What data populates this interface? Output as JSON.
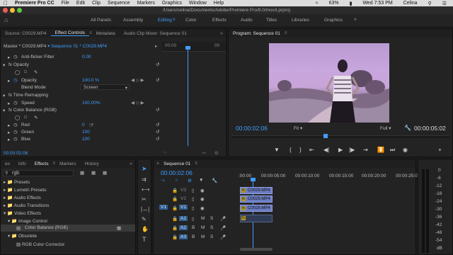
{
  "menubar": {
    "apple": "",
    "app": "Premiere Pro CC",
    "items": [
      "File",
      "Edit",
      "Clip",
      "Sequence",
      "Markers",
      "Graphics",
      "Window",
      "Help"
    ],
    "battery": "63%",
    "clock": "Wed 7:53 PM",
    "user": "Celina"
  },
  "path": "/Users/celina/Documents/Adobe/Premiere Pro/9.0/mov3.prproj",
  "workspaces": [
    "All Panels",
    "Assembly",
    "Editing",
    "Color",
    "Effects",
    "Audio",
    "Titles",
    "Libraries",
    "Graphics"
  ],
  "workspace_active": "Editing",
  "effect_controls": {
    "tabs": [
      "Source: C0029.MP4",
      "Effect Controls",
      "Metadata",
      "Audio Clip Mixer: Sequence 01"
    ],
    "master": "Master * C0029.MP4",
    "sequence": "Sequence 01 * C0029.MP4",
    "ruler_time": "00:00",
    "rows": {
      "anti_flicker": "Anti-flicker Filter",
      "anti_flicker_val": "0.00",
      "opacity_fx": "fx  Opacity",
      "opacity": "Opacity",
      "opacity_val": "100.0 %",
      "blend": "Blend Mode",
      "blend_val": "Screen",
      "time_remap": "fx  Time Remapping",
      "speed": "Speed",
      "speed_val": "100.00%",
      "color_balance": "fx  Color Balance (RGB)",
      "red": "Red",
      "red_val": "0",
      "green": "Green",
      "green_val": "100",
      "blue": "Blue",
      "blue_val": "100"
    },
    "timecode": "00:00:02:06"
  },
  "program": {
    "title": "Program: Sequence 01",
    "timecode": "00:00:02:06",
    "fit": "Fit",
    "quality": "Full",
    "duration": "00:00:05:02"
  },
  "effects": {
    "tabs": [
      "es",
      "Info",
      "Effects",
      "Markers",
      "History"
    ],
    "search": "rgb",
    "tree": [
      "Presets",
      "Lumetri Presets",
      "Audio Effects",
      "Audio Transitions",
      "Video Effects",
      "Image Control",
      "Color Balance (RGB)",
      "Obsolete",
      "RGB Color Corrector"
    ]
  },
  "timeline": {
    "title": "Sequence 01",
    "timecode": "00:00:02:06",
    "ruler": [
      ":00:00",
      "00:00:05:00",
      "00:00:10:00",
      "00:00:15:00",
      "00:00:20:00",
      "00:00:25:0"
    ],
    "tracks": [
      "V3",
      "V2",
      "V1",
      "A1",
      "A2",
      "A3"
    ],
    "source_v": "V1",
    "source_a": "A1",
    "clips": [
      "C0029.MP4",
      "C0029.MP4",
      "C0029.MP4"
    ],
    "fx_badge": "fx",
    "audio_letters": [
      "B",
      "M",
      "S"
    ],
    "meter_labels": [
      "0",
      "-6",
      "-12",
      "-18",
      "-24",
      "-30",
      "-36",
      "-42",
      "-48",
      "-54",
      "dB"
    ]
  },
  "colors": {
    "accent": "#3f9eff",
    "clip": "#6b7cc0",
    "bg": "#232323"
  }
}
